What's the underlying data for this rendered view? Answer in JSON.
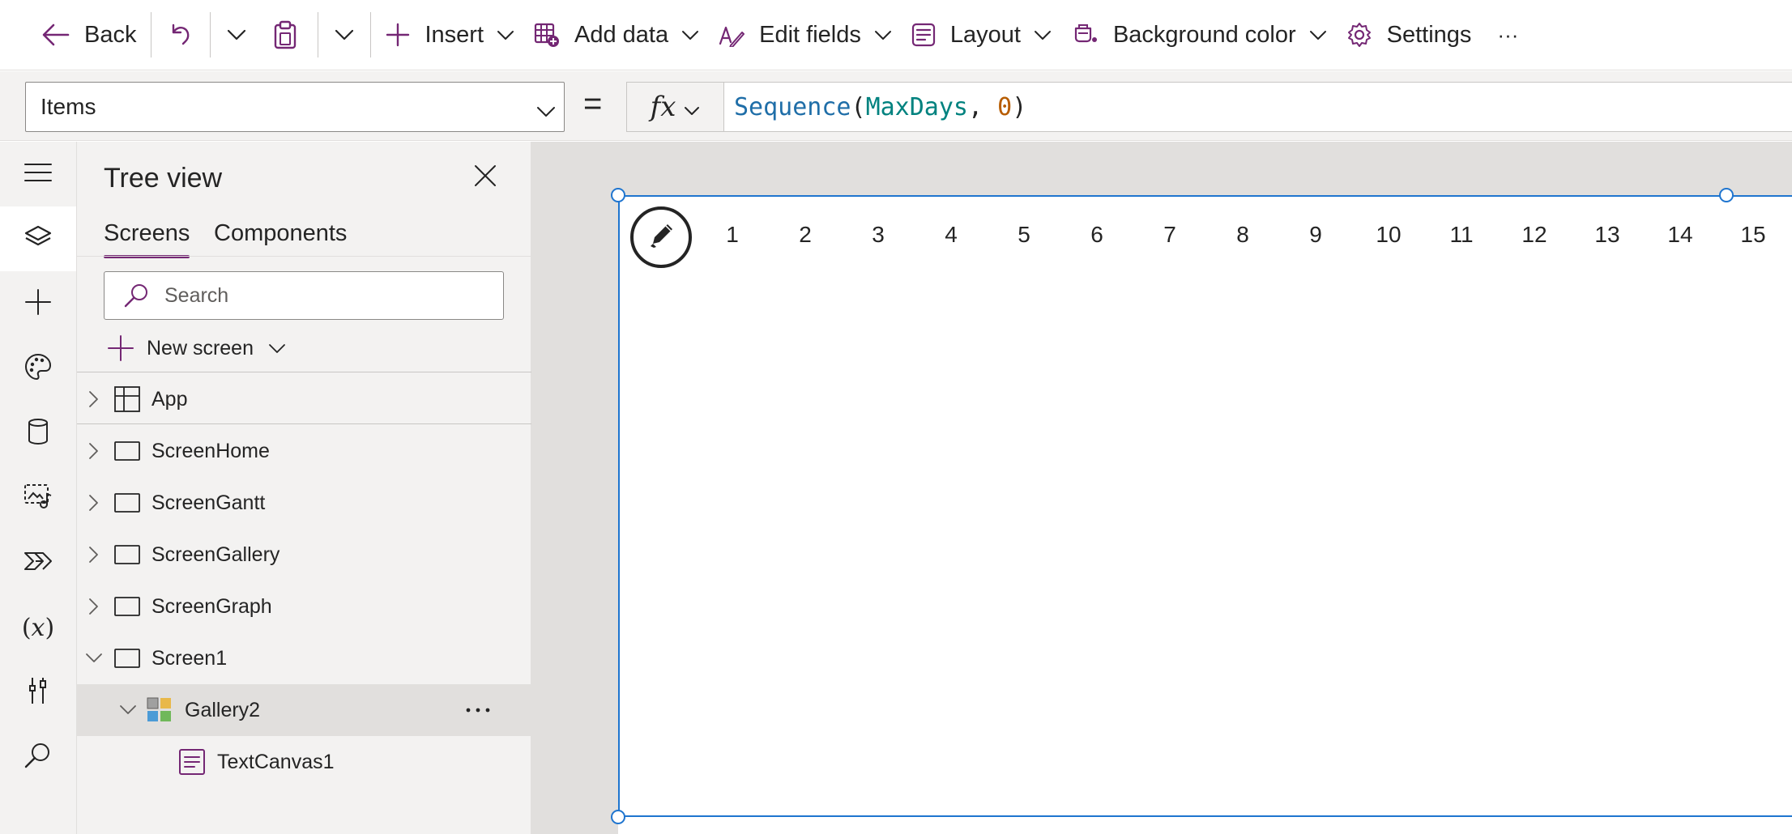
{
  "toolbar": {
    "back_label": "Back",
    "insert_label": "Insert",
    "add_data_label": "Add data",
    "edit_fields_label": "Edit fields",
    "layout_label": "Layout",
    "background_color_label": "Background color",
    "settings_label": "Settings",
    "more_label": "···"
  },
  "formula_bar": {
    "property": "Items",
    "equals": "=",
    "fx_label": "fx",
    "formula": {
      "fn": "Sequence",
      "open": "(",
      "arg1": "MaxDays",
      "comma": ", ",
      "arg2": "0",
      "close": ")"
    }
  },
  "rail": {
    "icons": [
      "hamburger-icon",
      "layers-icon",
      "plus-icon",
      "palette-icon",
      "database-icon",
      "media-icon",
      "power-automate-icon",
      "variables-icon",
      "tools-icon",
      "search-icon"
    ],
    "variables_glyph": "(𝑥)"
  },
  "tree": {
    "title": "Tree view",
    "tabs": [
      {
        "label": "Screens",
        "active": true
      },
      {
        "label": "Components",
        "active": false
      }
    ],
    "search_placeholder": "Search",
    "new_screen_label": "New screen",
    "nodes": [
      {
        "label": "App",
        "type": "app",
        "expanded": false
      },
      {
        "label": "ScreenHome",
        "type": "screen",
        "expanded": false
      },
      {
        "label": "ScreenGantt",
        "type": "screen",
        "expanded": false
      },
      {
        "label": "ScreenGallery",
        "type": "screen",
        "expanded": false
      },
      {
        "label": "ScreenGraph",
        "type": "screen",
        "expanded": false
      },
      {
        "label": "Screen1",
        "type": "screen",
        "expanded": true
      },
      {
        "label": "Gallery2",
        "type": "gallery",
        "expanded": true,
        "selected": true
      },
      {
        "label": "TextCanvas1",
        "type": "text",
        "expanded": false
      }
    ],
    "more_label": "···"
  },
  "canvas": {
    "gallery_items": [
      "1",
      "2",
      "3",
      "4",
      "5",
      "6",
      "7",
      "8",
      "9",
      "10",
      "11",
      "12",
      "13",
      "14",
      "15"
    ]
  },
  "colors": {
    "accent_purple": "#742774",
    "selection_blue": "#1f75cf",
    "formula_fn": "#1f6ea8",
    "formula_var": "#00827f",
    "formula_num": "#b75c00"
  }
}
